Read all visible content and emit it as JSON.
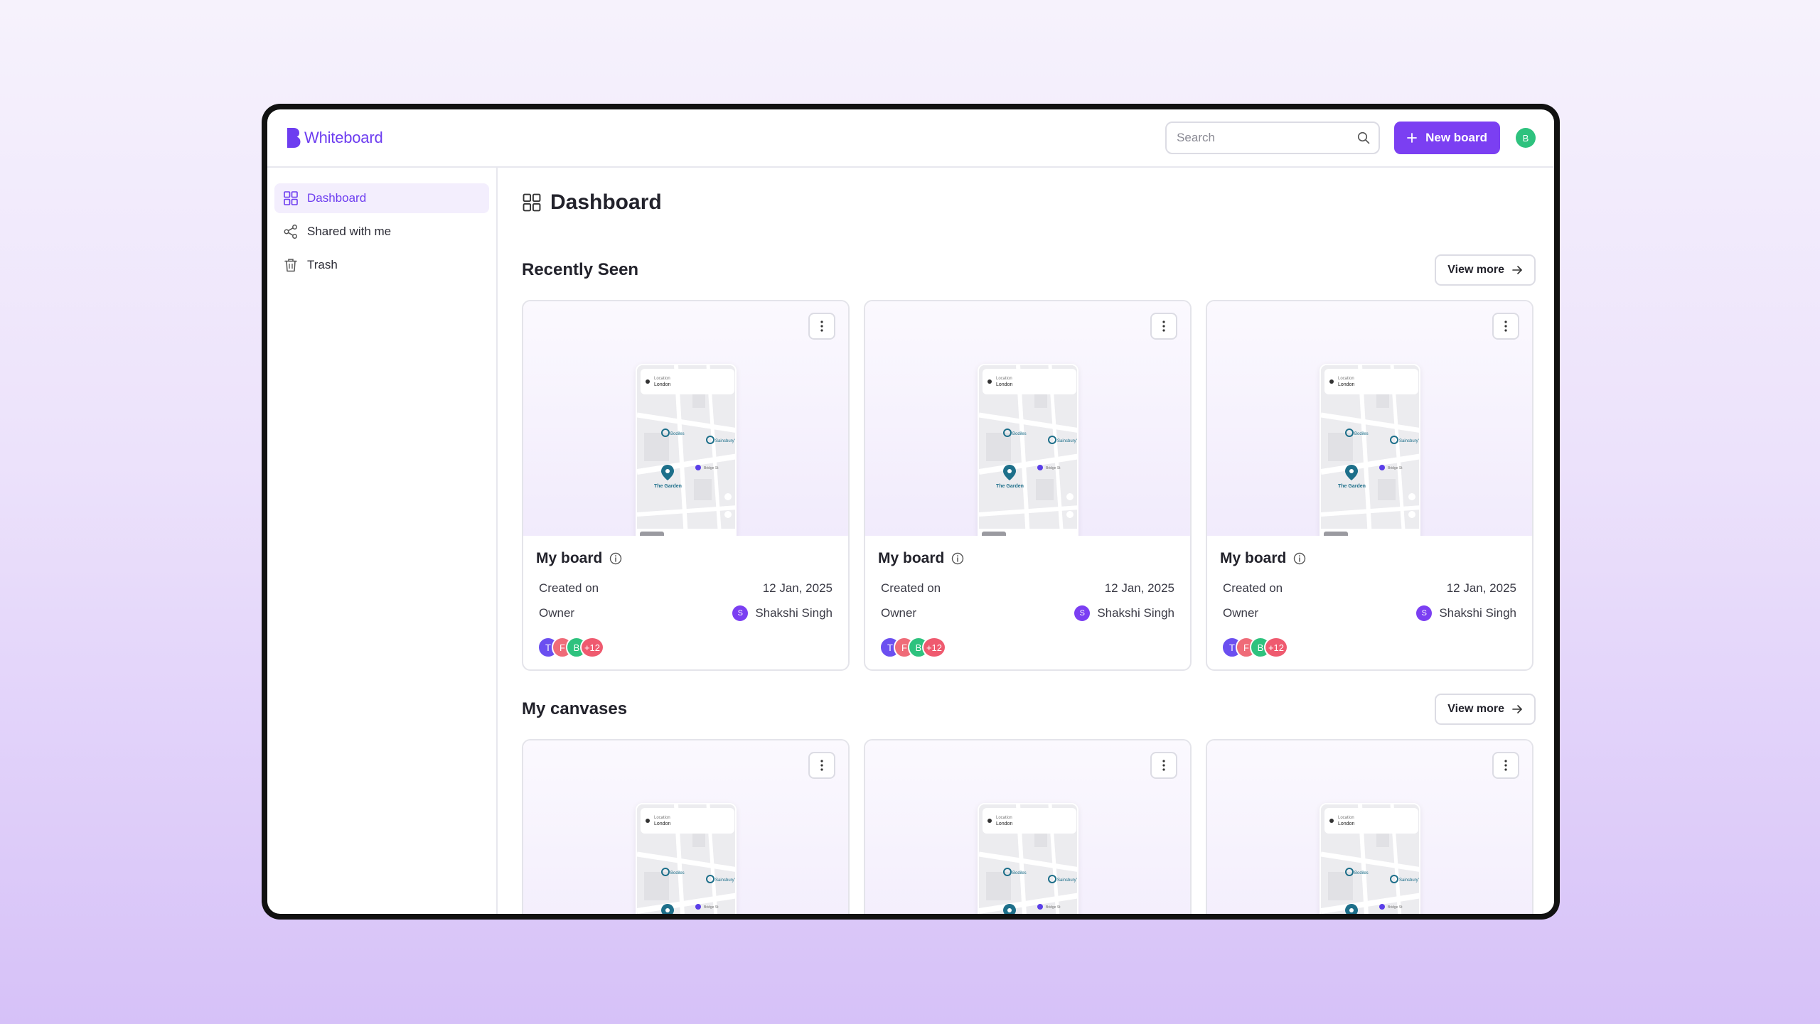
{
  "app": {
    "name": "Whiteboard"
  },
  "header": {
    "search_placeholder": "Search",
    "new_board_label": "New board",
    "user_initial": "B"
  },
  "sidebar": {
    "items": [
      {
        "label": "Dashboard",
        "icon": "grid-icon",
        "active": true
      },
      {
        "label": "Shared with me",
        "icon": "share-icon",
        "active": false
      },
      {
        "label": "Trash",
        "icon": "trash-icon",
        "active": false
      }
    ]
  },
  "main": {
    "title": "Dashboard",
    "sections": [
      {
        "title": "Recently Seen",
        "view_more_label": "View more",
        "cards": [
          {
            "title": "My board",
            "created_label": "Created on",
            "created_value": "12 Jan, 2025",
            "owner_label": "Owner",
            "owner_initial": "S",
            "owner_name": "Shakshi Singh",
            "collaborators": [
              "T",
              "F",
              "B"
            ],
            "collaborators_more": "+12"
          },
          {
            "title": "My board",
            "created_label": "Created on",
            "created_value": "12 Jan, 2025",
            "owner_label": "Owner",
            "owner_initial": "S",
            "owner_name": "Shakshi Singh",
            "collaborators": [
              "T",
              "F",
              "B"
            ],
            "collaborators_more": "+12"
          },
          {
            "title": "My board",
            "created_label": "Created on",
            "created_value": "12 Jan, 2025",
            "owner_label": "Owner",
            "owner_initial": "S",
            "owner_name": "Shakshi Singh",
            "collaborators": [
              "T",
              "F",
              "B"
            ],
            "collaborators_more": "+12"
          }
        ]
      },
      {
        "title": "My canvases",
        "view_more_label": "View more"
      }
    ]
  },
  "thumbnail": {
    "location_label": "Location",
    "location_value": "London",
    "place_name": "The Garden",
    "poi_1": "Bodiles",
    "poi_2": "Sainsbury's",
    "poi_3": "Bridge St"
  },
  "colors": {
    "accent": "#7b3ff2",
    "logo": "#6d3df0",
    "avatar_colors": [
      "#6b4ff0",
      "#ef6b78",
      "#2ec27e",
      "#ef5a6f"
    ],
    "user_avatar": "#2ec27e"
  }
}
